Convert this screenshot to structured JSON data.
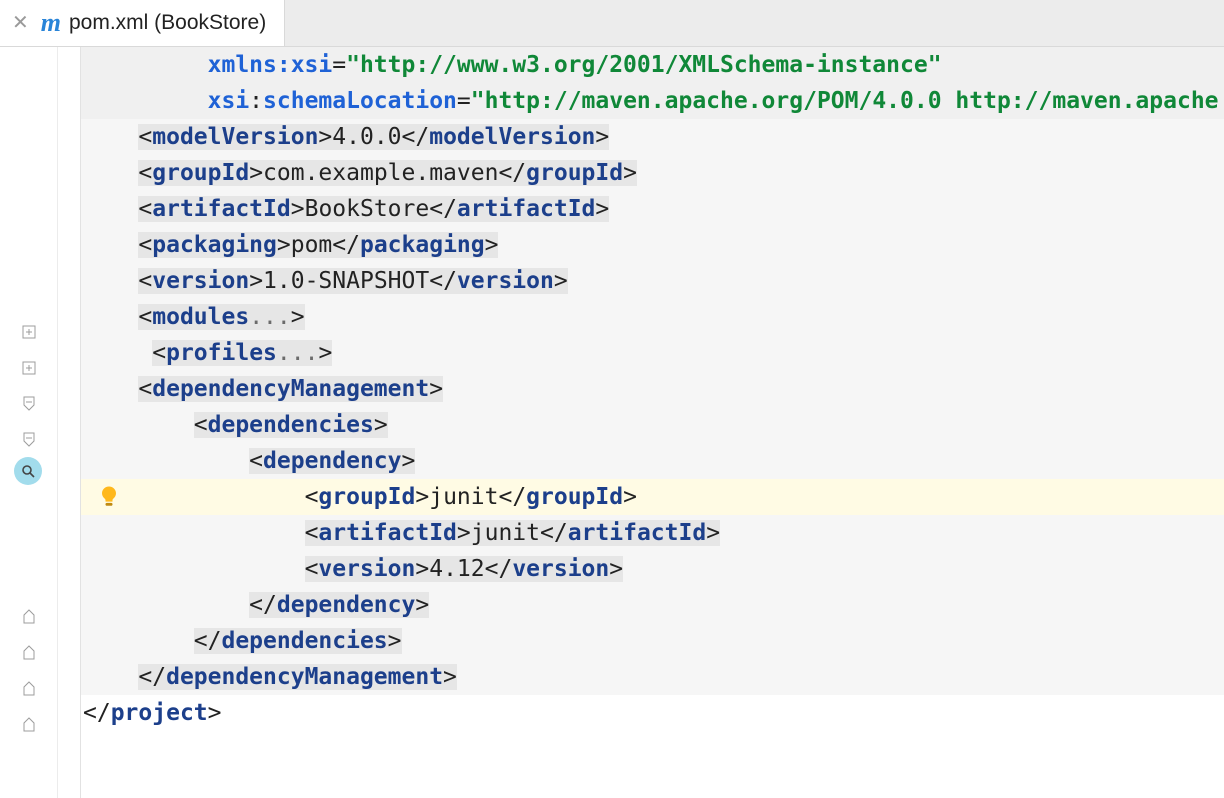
{
  "tab": {
    "title": "pom.xml (BookStore)"
  },
  "xml": {
    "xmlns_xsi_attr": "xmlns:xsi",
    "xmlns_xsi_val": "\"http://www.w3.org/2001/XMLSchema-instance\"",
    "schemaLoc_prefix": "xsi",
    "schemaLoc_local": "schemaLocation",
    "schemaLoc_val": "\"http://maven.apache.org/POM/4.0.0 http://maven.apache",
    "modelVersion_tag": "modelVersion",
    "modelVersion_val": "4.0.0",
    "groupId_tag": "groupId",
    "project_groupId_val": "com.example.maven",
    "artifactId_tag": "artifactId",
    "project_artifactId_val": "BookStore",
    "packaging_tag": "packaging",
    "packaging_val": "pom",
    "version_tag": "version",
    "project_version_val": "1.0-SNAPSHOT",
    "modules_tag": "modules",
    "profiles_tag": "profiles",
    "ellipsis": "...",
    "depMgmt_tag": "dependencyManagement",
    "deps_tag": "dependencies",
    "dep_tag": "dependency",
    "junit_groupId": "junit",
    "junit_artifactId": "junit",
    "junit_version": "4.12",
    "project_tag": "project"
  }
}
